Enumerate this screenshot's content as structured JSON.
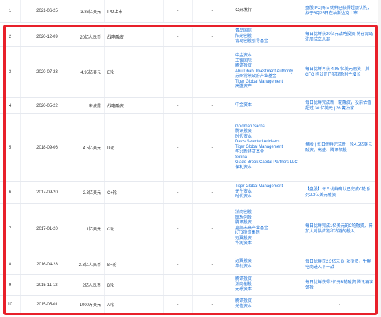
{
  "rows": [
    {
      "idx": "1",
      "date": "2021-06-25",
      "amount": "3.86亿美元",
      "round": "IPO上市",
      "d1": "-",
      "d2": "-",
      "investors": [
        "公开发行"
      ],
      "news": "盘股IPO|每日优鲜已获得超额认购，拟于6月25日在纳斯达克上市"
    },
    {
      "idx": "2",
      "date": "2020-12-09",
      "amount": "20亿人民币",
      "round": "战略融资",
      "d1": "-",
      "d2": "-",
      "investors": [
        "青岛国信",
        "阳光创投",
        "青岛创投引导基金"
      ],
      "news": "每日优鲜获20亿元战略投资 将在青岛注册成立总部"
    },
    {
      "idx": "3",
      "date": "2020-07-23",
      "amount": "4.95亿美元",
      "round": "E轮",
      "d1": "-",
      "d2": "-",
      "investors": [
        "中金资本",
        "工银国际",
        "腾讯投资",
        "Abu Dhabi Investment Authority",
        "苏州常熟政府产业基金",
        "Tiger Global Management",
        "高盛资产"
      ],
      "news": "每日优鲜再获 4.95 亿美元融资，其 CFO 称公司已实现盈利性增长"
    },
    {
      "idx": "4",
      "date": "2020-05-22",
      "amount": "未披露",
      "round": "战略融资",
      "d1": "-",
      "d2": "-",
      "investors": [
        "中金资本"
      ],
      "news": "每日优鲜完成新一轮融资，投前估值超过 30 亿美元 | 36 氪独家"
    },
    {
      "idx": "5",
      "date": "2018-09-06",
      "amount": "4.5亿美元",
      "round": "D轮",
      "d1": "-",
      "d2": "-",
      "investors": [
        "Goldman Sachs",
        "腾讯投资",
        "时代资本",
        "Davis Selected Advisers",
        "Tiger Global Management",
        "华兴新经济基金",
        "Sofina",
        "Glade Brook Capital Partners LLC",
        "保利资本"
      ],
      "news": "盘股 | 每日优鲜完成新一轮4.5亿美元融资，高盛、腾讯领投"
    },
    {
      "idx": "6",
      "date": "2017-09-20",
      "amount": "2.3亿美元",
      "round": "C+轮",
      "d1": "-",
      "d2": "-",
      "investors": [
        "Tiger Global Management",
        "元生资本",
        "时代资本"
      ],
      "news": "【盘股】每日优鲜确认已完成C轮系列2.3亿美元融资"
    },
    {
      "idx": "7",
      "date": "2017-01-20",
      "amount": "1亿美元",
      "round": "C轮",
      "d1": "-",
      "d2": "-",
      "investors": [
        "浙商创投",
        "联想创投",
        "腾讯投资",
        "嘉凯未来产业基金",
        "KTB投资集团",
        "远翼投资",
        "华润资本"
      ],
      "news": "每日优鲜完成1亿美元的C轮融资，将加大对供应链和冷链的投入"
    },
    {
      "idx": "8",
      "date": "2016-04-28",
      "amount": "2.3亿人民币",
      "round": "B+轮",
      "d1": "-",
      "d2": "-",
      "investors": [
        "远翼投资",
        "华创资本"
      ],
      "news": "每日优鲜获2.3亿元 B+轮投资，生鲜电商进入下一战"
    },
    {
      "idx": "9",
      "date": "2015-11-12",
      "amount": "2亿人民币",
      "round": "B轮",
      "d1": "-",
      "d2": "-",
      "investors": [
        "腾讯投资",
        "浙商创投",
        "元璟资本"
      ],
      "news": "每日优鲜获得2亿元B轮融资 腾讯再次领投"
    },
    {
      "idx": "10",
      "date": "2015-05-01",
      "amount": "1000万美元",
      "round": "A轮",
      "d1": "-",
      "d2": "-",
      "investors": [
        "腾讯投资",
        "光信资本"
      ],
      "news": "-"
    }
  ]
}
